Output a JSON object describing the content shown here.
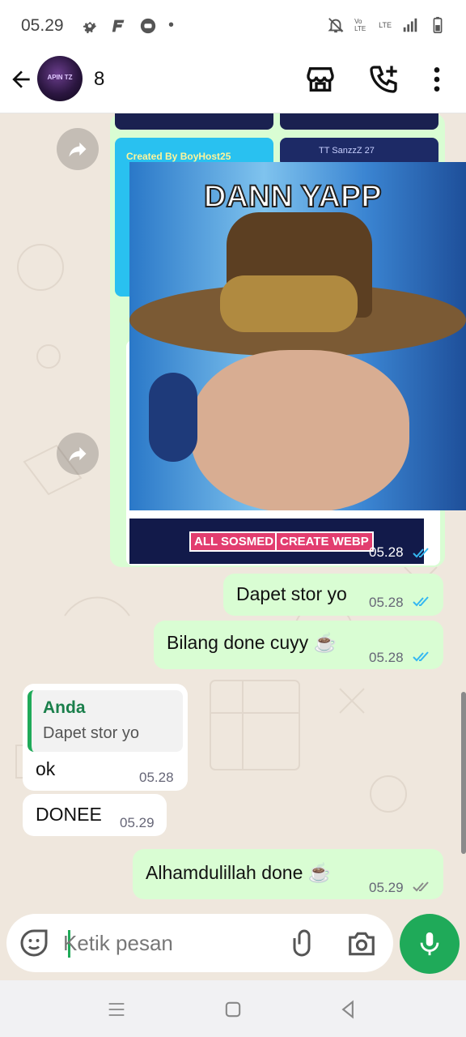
{
  "status_bar": {
    "time": "05.29",
    "dot": "•",
    "lte_label_1": "Vo LTE",
    "lte_label_2": "LTE"
  },
  "header": {
    "chat_name": "8",
    "avatar_text": "APIN TZ"
  },
  "media": {
    "card_label_1": "Created By BoyHost25",
    "card_label_2": "TT SanzzZ 27",
    "sticker_title": "DANN YAPP",
    "btn_all_sosmed": "ALL SOSMED",
    "btn_create_webp": "CREATE WEBP",
    "time": "05.28"
  },
  "messages": [
    {
      "text": "Dapet stor yo",
      "time": "05.28",
      "status": "read"
    },
    {
      "text": "Bilang done cuyy ☕",
      "time": "05.28",
      "status": "read"
    },
    {
      "quote_author": "Anda",
      "quote_text": "Dapet stor yo",
      "text": "ok",
      "time": "05.28"
    },
    {
      "text": "DONEE",
      "time": "05.29"
    },
    {
      "text": "Alhamdulillah done ☕",
      "time": "05.29",
      "status": "delivered"
    }
  ],
  "composer": {
    "placeholder": "Ketik pesan"
  },
  "colors": {
    "accent": "#1faa59",
    "read_tick": "#34b7f1",
    "outgoing_bubble": "#d9fdd3",
    "incoming_bubble": "#ffffff"
  },
  "icons": [
    "back-arrow-icon",
    "store-icon",
    "call-add-icon",
    "more-vert-icon",
    "forward-icon",
    "sticker-icon",
    "attach-icon",
    "camera-icon",
    "mic-icon"
  ]
}
